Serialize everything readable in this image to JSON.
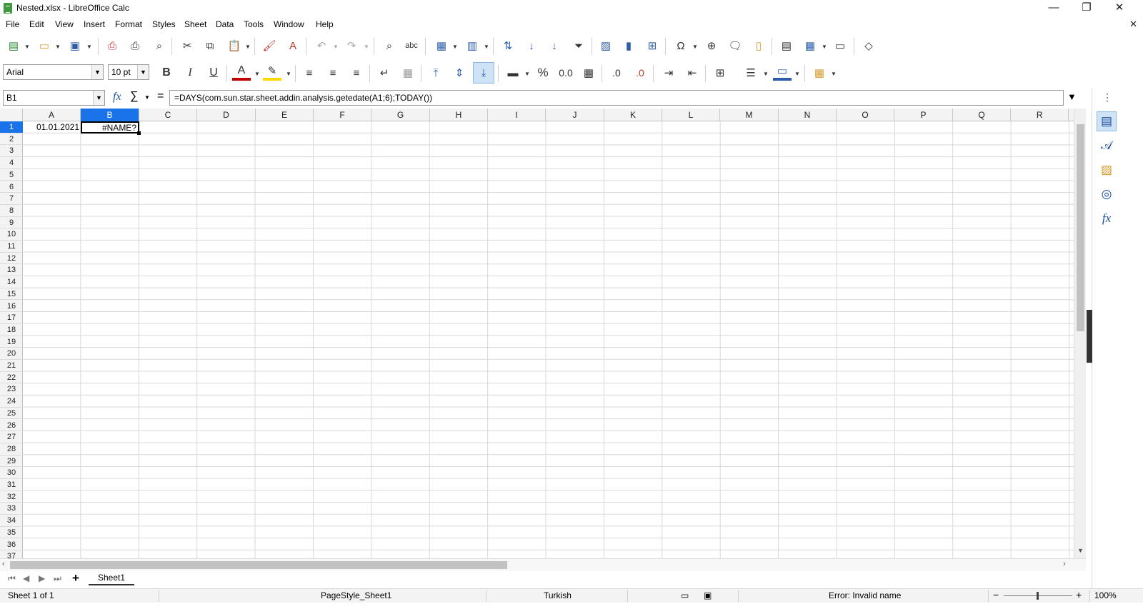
{
  "window": {
    "title": "Nested.xlsx - LibreOffice Calc",
    "minimize": "—",
    "restore": "❐",
    "close": "✕",
    "doc_close": "✕"
  },
  "menu": [
    "File",
    "Edit",
    "View",
    "Insert",
    "Format",
    "Styles",
    "Sheet",
    "Data",
    "Tools",
    "Window",
    "Help"
  ],
  "toolbar": {
    "font_name": "Arial",
    "font_size": "10 pt",
    "bold": "B",
    "italic": "I",
    "underline": "U",
    "percent": "%",
    "number_format": "0.0",
    "add_decimal": ".0",
    "del_decimal": ".0",
    "spelling": "abc"
  },
  "formula_bar": {
    "name_box": "B1",
    "fx": "fx",
    "sum": "∑",
    "equals": "=",
    "formula": "=DAYS(com.sun.star.sheet.addin.analysis.getedate(A1;6);TODAY())"
  },
  "grid": {
    "columns": [
      "A",
      "B",
      "C",
      "D",
      "E",
      "F",
      "G",
      "H",
      "I",
      "J",
      "K",
      "L",
      "M",
      "N",
      "O",
      "P",
      "Q",
      "R"
    ],
    "selected_column": "B",
    "rows": [
      "1",
      "2",
      "3",
      "4",
      "5",
      "6",
      "7",
      "8",
      "9",
      "10",
      "11",
      "12",
      "13",
      "14",
      "15",
      "16",
      "17",
      "18",
      "19",
      "20",
      "21",
      "22",
      "23",
      "24",
      "25",
      "26",
      "27",
      "28",
      "29",
      "30",
      "31",
      "32",
      "33",
      "34",
      "35",
      "36",
      "37"
    ],
    "selected_row": "1",
    "cells": {
      "A1": "01.01.2021",
      "B1": "#NAME?"
    }
  },
  "sheet_tabs": {
    "tabs": [
      "Sheet1"
    ],
    "add": "+"
  },
  "status_bar": {
    "sheet_info": "Sheet 1 of 1",
    "page_style": "PageStyle_Sheet1",
    "language": "Turkish",
    "message": "Error: Invalid name",
    "zoom": "100%",
    "zoom_minus": "−",
    "zoom_plus": "+"
  },
  "colors": {
    "selection": "#1a73e8",
    "accent_icon": "#1c4f9c",
    "font_color_bar": "#c00000",
    "highlight_bar": "#ffd800"
  }
}
